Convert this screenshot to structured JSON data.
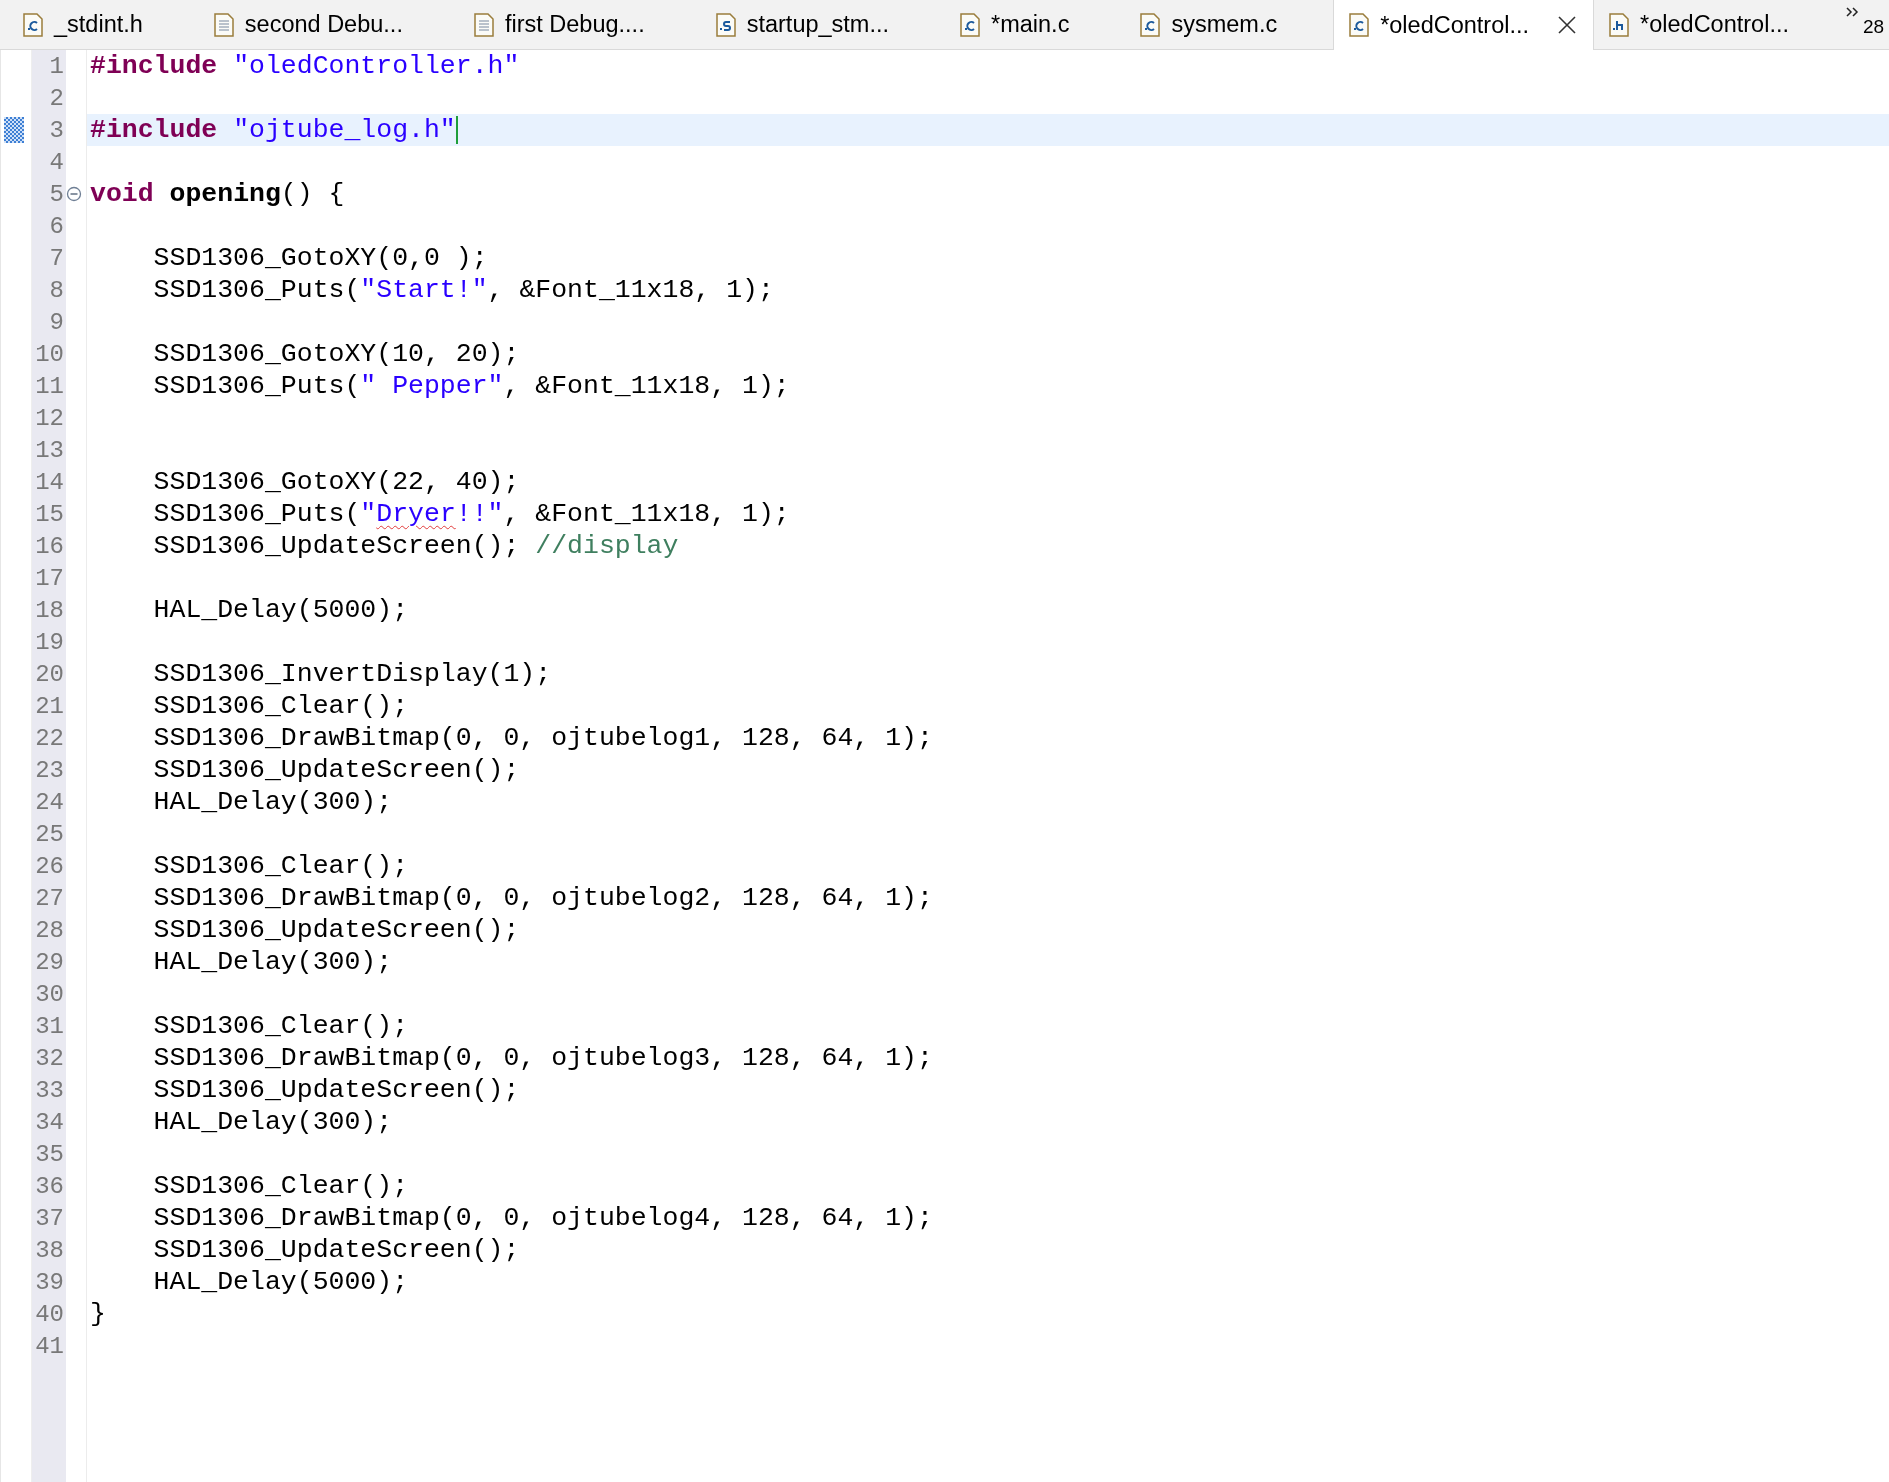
{
  "tabs": [
    {
      "label": "_stdint.h",
      "kind": "c",
      "selected": false
    },
    {
      "label": "second Debu...",
      "kind": "text",
      "selected": false
    },
    {
      "label": "first Debug....",
      "kind": "text",
      "selected": false
    },
    {
      "label": "startup_stm...",
      "kind": "s",
      "selected": false
    },
    {
      "label": "*main.c",
      "kind": "c",
      "selected": false
    },
    {
      "label": "sysmem.c",
      "kind": "c",
      "selected": false
    },
    {
      "label": "*oledControl...",
      "kind": "c",
      "selected": true
    },
    {
      "label": "*oledControl...",
      "kind": "h",
      "selected": false
    }
  ],
  "hidden_tab_count": "28",
  "lines": [
    {
      "number": "1",
      "current": false,
      "tokens": [
        {
          "kind": "preprocessor",
          "text": "#include "
        },
        {
          "kind": "string",
          "text": "\"oledController.h\""
        }
      ]
    },
    {
      "number": "2",
      "current": false
    },
    {
      "number": "3",
      "current": true,
      "tokens": [
        {
          "kind": "preprocessor",
          "text": "#include "
        },
        {
          "kind": "string",
          "text": "\"ojtube_log.h\""
        }
      ]
    },
    {
      "number": "4",
      "current": false
    },
    {
      "number": "5",
      "current": false,
      "expanded": true,
      "tokens": [
        {
          "kind": "keyword",
          "text": "void "
        },
        {
          "kind": "declaration",
          "text": "opening"
        },
        {
          "kind": "plain",
          "text": "() {"
        }
      ]
    },
    {
      "number": "6",
      "current": false
    },
    {
      "number": "7",
      "current": false,
      "tokens": [
        {
          "kind": "plain",
          "text": "    SSD1306_GotoXY(0,0 );"
        }
      ]
    },
    {
      "number": "8",
      "current": false,
      "tokens": [
        {
          "kind": "plain",
          "text": "    SSD1306_Puts("
        },
        {
          "kind": "string",
          "text": "\"Start!\""
        },
        {
          "kind": "plain",
          "text": ", &Font_11x18, 1);"
        }
      ]
    },
    {
      "number": "9",
      "current": false
    },
    {
      "number": "10",
      "current": false,
      "tokens": [
        {
          "kind": "plain",
          "text": "    SSD1306_GotoXY(10, 20);"
        }
      ]
    },
    {
      "number": "11",
      "current": false,
      "tokens": [
        {
          "kind": "plain",
          "text": "    SSD1306_Puts("
        },
        {
          "kind": "string",
          "text": "\" Pepper\""
        },
        {
          "kind": "plain",
          "text": ", &Font_11x18, 1);"
        }
      ]
    },
    {
      "number": "12",
      "current": false
    },
    {
      "number": "13",
      "current": false
    },
    {
      "number": "14",
      "current": false,
      "tokens": [
        {
          "kind": "plain",
          "text": "    SSD1306_GotoXY(22, 40);"
        }
      ]
    },
    {
      "number": "15",
      "current": false,
      "tokens": [
        {
          "kind": "plain",
          "text": "    SSD1306_Puts("
        },
        {
          "kind": "string",
          "text": "\""
        },
        {
          "kind": "misspelled_string",
          "text": "Dryer"
        },
        {
          "kind": "string",
          "text": "!!\""
        },
        {
          "kind": "plain",
          "text": ", &Font_11x18, 1);"
        }
      ]
    },
    {
      "number": "16",
      "current": false,
      "tokens": [
        {
          "kind": "plain",
          "text": "    SSD1306_UpdateScreen(); "
        },
        {
          "kind": "comment",
          "text": "//display"
        }
      ]
    },
    {
      "number": "17",
      "current": false
    },
    {
      "number": "18",
      "current": false,
      "tokens": [
        {
          "kind": "plain",
          "text": "    HAL_Delay(5000);"
        }
      ]
    },
    {
      "number": "19",
      "current": false
    },
    {
      "number": "20",
      "current": false,
      "tokens": [
        {
          "kind": "plain",
          "text": "    SSD1306_InvertDisplay(1);"
        }
      ]
    },
    {
      "number": "21",
      "current": false,
      "tokens": [
        {
          "kind": "plain",
          "text": "    SSD1306_Clear();"
        }
      ]
    },
    {
      "number": "22",
      "current": false,
      "tokens": [
        {
          "kind": "plain",
          "text": "    SSD1306_DrawBitmap(0, 0, ojtubelog1, 128, 64, 1);"
        }
      ]
    },
    {
      "number": "23",
      "current": false,
      "tokens": [
        {
          "kind": "plain",
          "text": "    SSD1306_UpdateScreen();"
        }
      ]
    },
    {
      "number": "24",
      "current": false,
      "tokens": [
        {
          "kind": "plain",
          "text": "    HAL_Delay(300);"
        }
      ]
    },
    {
      "number": "25",
      "current": false
    },
    {
      "number": "26",
      "current": false,
      "tokens": [
        {
          "kind": "plain",
          "text": "    SSD1306_Clear();"
        }
      ]
    },
    {
      "number": "27",
      "current": false,
      "tokens": [
        {
          "kind": "plain",
          "text": "    SSD1306_DrawBitmap(0, 0, ojtubelog2, 128, 64, 1);"
        }
      ]
    },
    {
      "number": "28",
      "current": false,
      "tokens": [
        {
          "kind": "plain",
          "text": "    SSD1306_UpdateScreen();"
        }
      ]
    },
    {
      "number": "29",
      "current": false,
      "tokens": [
        {
          "kind": "plain",
          "text": "    HAL_Delay(300);"
        }
      ]
    },
    {
      "number": "30",
      "current": false
    },
    {
      "number": "31",
      "current": false,
      "tokens": [
        {
          "kind": "plain",
          "text": "    SSD1306_Clear();"
        }
      ]
    },
    {
      "number": "32",
      "current": false,
      "tokens": [
        {
          "kind": "plain",
          "text": "    SSD1306_DrawBitmap(0, 0, ojtubelog3, 128, 64, 1);"
        }
      ]
    },
    {
      "number": "33",
      "current": false,
      "tokens": [
        {
          "kind": "plain",
          "text": "    SSD1306_UpdateScreen();"
        }
      ]
    },
    {
      "number": "34",
      "current": false,
      "tokens": [
        {
          "kind": "plain",
          "text": "    HAL_Delay(300);"
        }
      ]
    },
    {
      "number": "35",
      "current": false
    },
    {
      "number": "36",
      "current": false,
      "tokens": [
        {
          "kind": "plain",
          "text": "    SSD1306_Clear();"
        }
      ]
    },
    {
      "number": "37",
      "current": false,
      "tokens": [
        {
          "kind": "plain",
          "text": "    SSD1306_DrawBitmap(0, 0, ojtubelog4, 128, 64, 1);"
        }
      ]
    },
    {
      "number": "38",
      "current": false,
      "tokens": [
        {
          "kind": "plain",
          "text": "    SSD1306_UpdateScreen();"
        }
      ]
    },
    {
      "number": "39",
      "current": false,
      "tokens": [
        {
          "kind": "plain",
          "text": "    HAL_Delay(5000);"
        }
      ]
    },
    {
      "number": "40",
      "current": false,
      "tokens": [
        {
          "kind": "plain",
          "text": "}"
        }
      ]
    },
    {
      "number": "41",
      "current": false
    }
  ]
}
